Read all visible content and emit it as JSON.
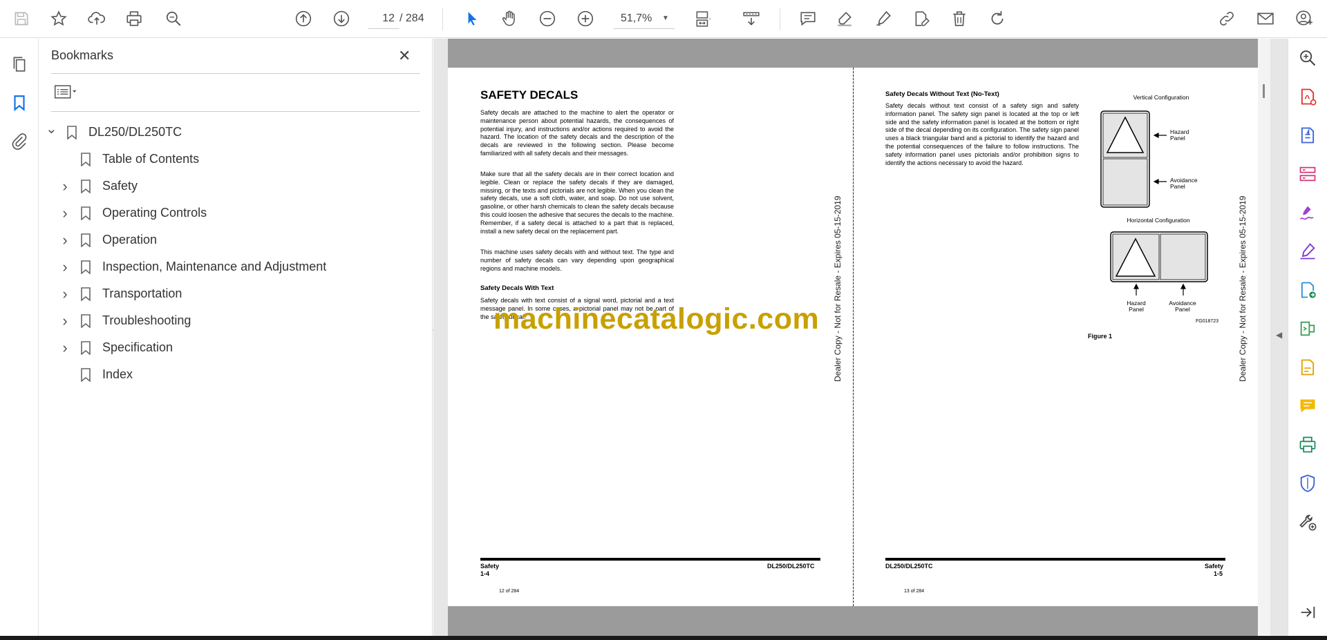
{
  "toolbar": {
    "page_current": "12",
    "page_total": "/  284",
    "zoom": "51,7%",
    "icons": [
      "save-icon",
      "star-icon",
      "upload-icon",
      "print-icon",
      "zoom-search-icon",
      "prev-page-icon",
      "next-page-icon",
      "select-arrow-icon",
      "hand-icon",
      "zoom-out-icon",
      "zoom-in-icon",
      "fit-page-icon",
      "scroll-mode-icon",
      "comment-icon",
      "highlight-icon",
      "sign-icon",
      "edit-pdf-icon",
      "delete-icon",
      "rotate-icon",
      "link-icon",
      "mail-icon",
      "account-icon"
    ]
  },
  "left_rail": {
    "icons": [
      "pages-icon",
      "bookmarks-icon",
      "attachments-icon"
    ]
  },
  "bookmarks": {
    "title": "Bookmarks",
    "close": "✕",
    "items": [
      {
        "label": "DL250/DL250TC",
        "level": 0,
        "expander": "expanded"
      },
      {
        "label": "Table of Contents",
        "level": 1,
        "expander": "none"
      },
      {
        "label": "Safety",
        "level": 1,
        "expander": "collapsed"
      },
      {
        "label": "Operating Controls",
        "level": 1,
        "expander": "collapsed"
      },
      {
        "label": "Operation",
        "level": 1,
        "expander": "collapsed"
      },
      {
        "label": "Inspection, Maintenance and Adjustment",
        "level": 1,
        "expander": "collapsed"
      },
      {
        "label": "Transportation",
        "level": 1,
        "expander": "collapsed"
      },
      {
        "label": "Troubleshooting",
        "level": 1,
        "expander": "collapsed"
      },
      {
        "label": "Specification",
        "level": 1,
        "expander": "collapsed"
      },
      {
        "label": "Index",
        "level": 1,
        "expander": "none"
      }
    ]
  },
  "document": {
    "left_page": {
      "heading": "SAFETY DECALS",
      "para1": "Safety decals are attached to the machine to alert the operator or maintenance person about potential hazards, the consequences of potential injury, and instructions and/or actions required to avoid the hazard. The location of the safety decals and the description of the decals are reviewed in the following section. Please become familiarized with all safety decals and their messages.",
      "para2": "Make sure that all the safety decals are in their correct location and legible. Clean or replace the safety decals if they are damaged, missing, or the texts and pictorials are not legible. When you clean the safety decals, use a soft cloth, water, and soap. Do not use solvent, gasoline, or other harsh chemicals to clean the safety decals because this could loosen the adhesive that secures the decals to the machine. Remember, if a safety decal is attached to a part that is replaced, install a new safety decal on the replacement part.",
      "para3": "This machine uses safety decals with and without text. The type and number of safety decals can vary depending upon geographical regions and machine models.",
      "sub1": "Safety Decals With Text",
      "para4": "Safety decals with text consist of a signal word, pictorial and a text message panel. In some cases, a pictorial panel may not be part of the safety decal.",
      "footer_left": "Safety",
      "footer_left_num": "1-4",
      "footer_right": "DL250/DL250TC",
      "page_num": "12 of 284"
    },
    "right_page": {
      "sub1": "Safety Decals Without Text (No-Text)",
      "para1": "Safety decals without text consist of a safety sign and safety information panel. The safety sign panel is located at the top or left side and the safety information panel is located at the bottom or right side of the decal depending on its configuration. The safety sign panel uses a black triangular band and a pictorial to identify the hazard and the potential consequences of the failure to follow instructions. The safety information panel uses pictorials and/or prohibition signs to identify the actions necessary to avoid the hazard.",
      "vertical_config": "Vertical Configuration",
      "horizontal_config": "Horizontal Configuration",
      "hazard_panel": "Hazard Panel",
      "avoidance_panel": "Avoidance Panel",
      "fig_code": "FG018723",
      "figure": "Figure 1",
      "footer_left": "DL250/DL250TC",
      "footer_right": "Safety",
      "footer_right_num": "1-5",
      "page_num": "13 of 284"
    },
    "side_stamp": "Dealer Copy - Not for Resale - Expires 05-15-2019",
    "watermark": "machinecatalogic.com"
  },
  "right_rail": {
    "icons": [
      "zoom-tool-icon",
      "export-pdf-icon",
      "create-pdf-icon",
      "organize-pages-icon",
      "fill-sign-icon",
      "request-signature-icon",
      "convert-icon",
      "compress-icon",
      "edit-icon",
      "comment-tool-icon",
      "print-production-icon",
      "protect-icon",
      "more-tools-icon",
      "expand-icon"
    ]
  },
  "colors": {
    "accent_blue": "#1473e6",
    "watermark": "#c8a000"
  }
}
